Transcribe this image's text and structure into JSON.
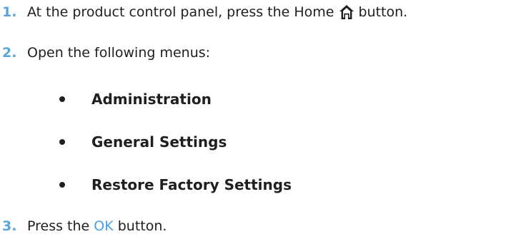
{
  "steps": [
    {
      "number": "1.",
      "text_before": "At the product control panel, press the Home",
      "icon": "home-icon",
      "text_after": "button."
    },
    {
      "number": "2.",
      "text": "Open the following menus:"
    },
    {
      "number": "3.",
      "text_before": "Press the",
      "highlight": "OK",
      "text_after": "button."
    }
  ],
  "menus": [
    "Administration",
    "General Settings",
    "Restore Factory Settings"
  ],
  "colors": {
    "step_number": "#5aa6dc",
    "ok_highlight": "#4aa3e0",
    "text": "#1f1f1f"
  }
}
